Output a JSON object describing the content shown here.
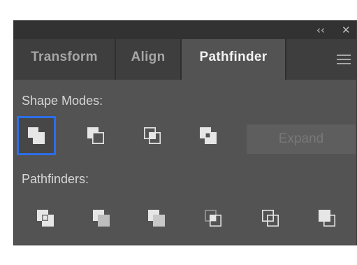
{
  "titlebar": {
    "collapse_glyph": "‹‹",
    "close_glyph": "✕"
  },
  "tabs": [
    {
      "label": "Transform"
    },
    {
      "label": "Align"
    },
    {
      "label": "Pathfinder",
      "active": true
    }
  ],
  "menu_icon": "hamburger-menu-icon",
  "shape_modes": {
    "label": "Shape Modes:",
    "selected": "unite",
    "buttons": [
      {
        "name": "unite",
        "icon": "unite-icon"
      },
      {
        "name": "minus-front",
        "icon": "minus-front-icon"
      },
      {
        "name": "intersect",
        "icon": "intersect-icon"
      },
      {
        "name": "exclude",
        "icon": "exclude-icon"
      }
    ],
    "expand_label": "Expand"
  },
  "pathfinders": {
    "label": "Pathfinders:",
    "buttons": [
      {
        "name": "divide",
        "icon": "divide-icon"
      },
      {
        "name": "trim",
        "icon": "trim-icon"
      },
      {
        "name": "merge",
        "icon": "merge-icon"
      },
      {
        "name": "crop",
        "icon": "crop-icon"
      },
      {
        "name": "outline",
        "icon": "outline-icon"
      },
      {
        "name": "minus-back",
        "icon": "minus-back-icon"
      }
    ]
  },
  "colors": {
    "panel_bg": "#535353",
    "tab_bar_bg": "#3e3e3e",
    "title_bar_bg": "#323232",
    "icon_color": "#e6e6e6",
    "selection_border": "#2d6ee8"
  }
}
